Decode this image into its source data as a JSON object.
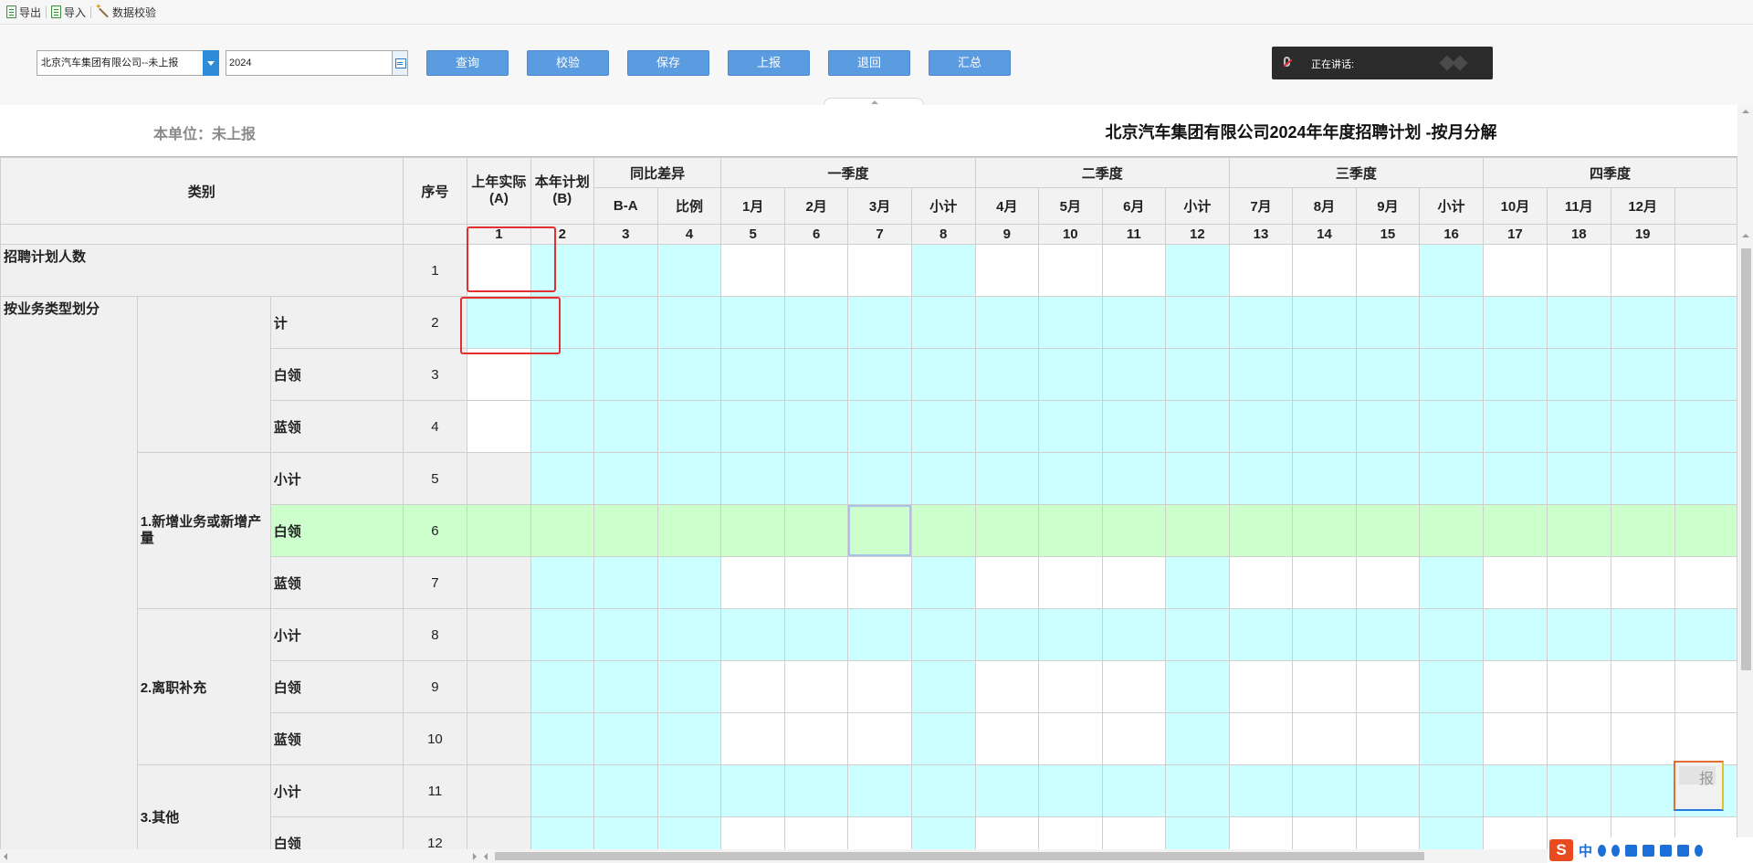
{
  "toolbar": {
    "export_label": "导出",
    "import_label": "导入",
    "validate_label": "数据校验"
  },
  "filters": {
    "unit": "北京汽车集团有限公司--未上报",
    "year": "2024"
  },
  "actions": {
    "query": "查询",
    "check": "校验",
    "save": "保存",
    "submit": "上报",
    "reject": "退回",
    "summary": "汇总"
  },
  "speaking": {
    "label": "正在讲话:"
  },
  "report": {
    "unit_status": "本单位：未上报",
    "title": "北京汽车集团有限公司2024年年度招聘计划 -按月分解"
  },
  "grid": {
    "header": {
      "category": "类别",
      "seq": "序号",
      "last_year_actual": "上年实际(A)",
      "this_year_plan": "本年计划(B)",
      "yoy_diff": "同比差异",
      "b_minus_a": "B-A",
      "ratio": "比例",
      "quarters": [
        {
          "label": "一季度",
          "months": [
            "1月",
            "2月",
            "3月",
            "小计"
          ]
        },
        {
          "label": "二季度",
          "months": [
            "4月",
            "5月",
            "6月",
            "小计"
          ]
        },
        {
          "label": "三季度",
          "months": [
            "7月",
            "8月",
            "9月",
            "小计"
          ]
        },
        {
          "label": "四季度",
          "months": [
            "10月",
            "11月",
            "12月"
          ]
        }
      ],
      "column_numbers": [
        "1",
        "2",
        "3",
        "4",
        "5",
        "6",
        "7",
        "8",
        "9",
        "10",
        "11",
        "12",
        "13",
        "14",
        "15",
        "16",
        "17",
        "18",
        "19"
      ]
    },
    "labels": {
      "recruit_total": "招聘计划人数",
      "by_business_type": "按业务类型划分",
      "group_new_business": "1.新增业务或新增产量",
      "group_attrition": "2.离职补充",
      "group_other": "3.其他",
      "total": "计",
      "subtotal": "小计",
      "white_collar": "白领",
      "blue_collar": "蓝领"
    },
    "seq_numbers": [
      "1",
      "2",
      "3",
      "4",
      "5",
      "6",
      "7",
      "8",
      "9",
      "10",
      "11",
      "12"
    ]
  },
  "colors": {
    "cyan_cell": "#ccffff",
    "green_highlight": "#ccffcc",
    "button_blue": "#5b9be0",
    "annotation_red": "#e03030"
  },
  "float_widget": {
    "text": "报"
  },
  "ime": {
    "logo": "S",
    "mode": "中"
  }
}
